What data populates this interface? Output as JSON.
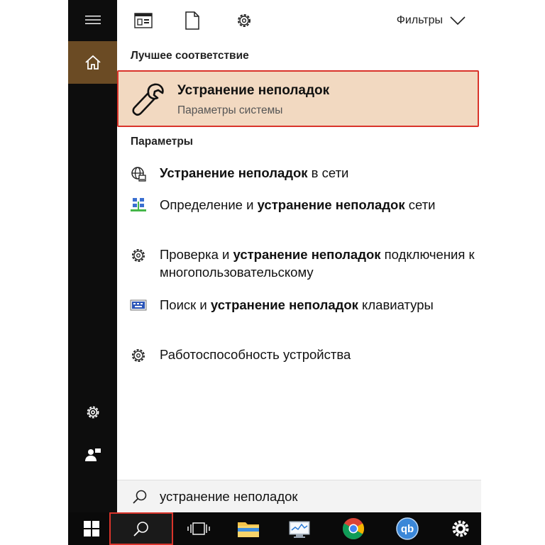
{
  "toolbar": {
    "filters_label": "Фильтры"
  },
  "best_match": {
    "heading": "Лучшее соответствие",
    "title": "Устранение неполадок",
    "subtitle": "Параметры системы"
  },
  "settings_section": {
    "heading": "Параметры",
    "results": [
      {
        "icon": "globe-network-icon",
        "bold": "Устранение неполадок",
        "after": " в сети"
      },
      {
        "icon": "network-computers-icon",
        "before": "Определение и ",
        "bold": "устранение неполадок",
        "after": " сети"
      },
      {
        "icon": "gear-icon",
        "before": "Проверка и ",
        "bold": "устранение неполадок",
        "after": " подключения к многопользовательскому"
      },
      {
        "icon": "keyboard-screen-icon",
        "before": "Поиск и ",
        "bold": "устранение неполадок",
        "after": " клавиатуры"
      },
      {
        "icon": "gear-icon",
        "before": "Работоспособность устройства"
      }
    ]
  },
  "search": {
    "query": "устранение неполадок"
  },
  "colors": {
    "rail_bg": "#0d0d0d",
    "home_accent": "#6b4b24",
    "best_match_bg": "#f2d9c1",
    "highlight_border": "#d9342b",
    "taskbar_bg": "#0a0a0a"
  }
}
